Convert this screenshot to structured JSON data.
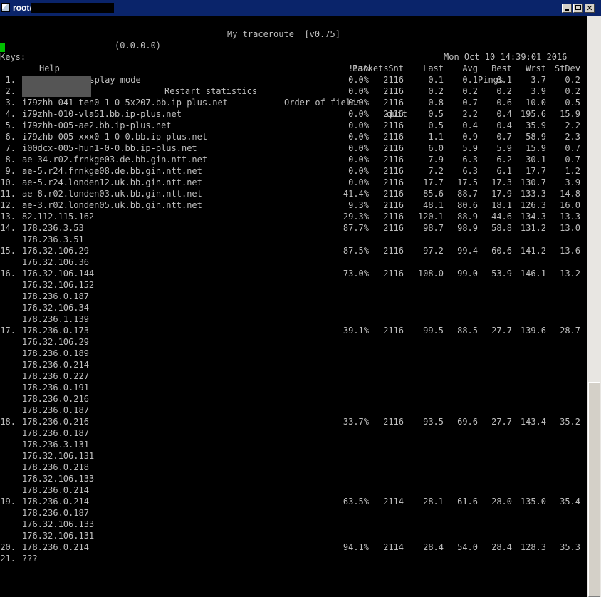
{
  "window": {
    "title": "root@",
    "buttons": {
      "minimize": "minimize",
      "maximize": "maximize",
      "close": "✕"
    }
  },
  "mtr": {
    "title": "My traceroute  [v0.75]",
    "address": "(0.0.0.0)",
    "datetime": "Mon Oct 10 14:39:01 2016",
    "keys_label": "Keys:",
    "menu": [
      "Help",
      "Display mode",
      "Restart statistics",
      "Order of fields",
      "quit"
    ],
    "group_headers": {
      "packets": "Packets",
      "pings": "Pings"
    },
    "columns": [
      "!!s%",
      "Snt",
      "Last",
      "Avg",
      "Best",
      "Wrst",
      "StDev"
    ],
    "hops": [
      {
        "n": "1.",
        "hosts": [
          ""
        ],
        "loss": "0.0%",
        "snt": "2116",
        "last": "0.1",
        "avg": "0.1",
        "best": "0.1",
        "wrst": "3.7",
        "stdev": "0.2"
      },
      {
        "n": "2.",
        "hosts": [
          ""
        ],
        "loss": "0.0%",
        "snt": "2116",
        "last": "0.2",
        "avg": "0.2",
        "best": "0.2",
        "wrst": "3.9",
        "stdev": "0.2"
      },
      {
        "n": "3.",
        "hosts": [
          "i79zhh-041-ten0-1-0-5x207.bb.ip-plus.net"
        ],
        "loss": "0.0%",
        "snt": "2116",
        "last": "0.8",
        "avg": "0.7",
        "best": "0.6",
        "wrst": "10.0",
        "stdev": "0.5"
      },
      {
        "n": "4.",
        "hosts": [
          "i79zhh-010-vla51.bb.ip-plus.net"
        ],
        "loss": "0.0%",
        "snt": "2116",
        "last": "0.5",
        "avg": "2.2",
        "best": "0.4",
        "wrst": "195.6",
        "stdev": "15.9"
      },
      {
        "n": "5.",
        "hosts": [
          "i79zhh-005-ae2.bb.ip-plus.net"
        ],
        "loss": "0.0%",
        "snt": "2116",
        "last": "0.5",
        "avg": "0.4",
        "best": "0.4",
        "wrst": "35.9",
        "stdev": "2.2"
      },
      {
        "n": "6.",
        "hosts": [
          "i79zhb-005-xxx0-1-0-0.bb.ip-plus.net"
        ],
        "loss": "0.0%",
        "snt": "2116",
        "last": "1.1",
        "avg": "0.9",
        "best": "0.7",
        "wrst": "58.9",
        "stdev": "2.3"
      },
      {
        "n": "7.",
        "hosts": [
          "i00dcx-005-hun1-0-0.bb.ip-plus.net"
        ],
        "loss": "0.0%",
        "snt": "2116",
        "last": "6.0",
        "avg": "5.9",
        "best": "5.9",
        "wrst": "15.9",
        "stdev": "0.7"
      },
      {
        "n": "8.",
        "hosts": [
          "ae-34.r02.frnkge03.de.bb.gin.ntt.net"
        ],
        "loss": "0.0%",
        "snt": "2116",
        "last": "7.9",
        "avg": "6.3",
        "best": "6.2",
        "wrst": "30.1",
        "stdev": "0.7"
      },
      {
        "n": "9.",
        "hosts": [
          "ae-5.r24.frnkge08.de.bb.gin.ntt.net"
        ],
        "loss": "0.0%",
        "snt": "2116",
        "last": "7.2",
        "avg": "6.3",
        "best": "6.1",
        "wrst": "17.7",
        "stdev": "1.2"
      },
      {
        "n": "10.",
        "hosts": [
          "ae-5.r24.londen12.uk.bb.gin.ntt.net"
        ],
        "loss": "0.0%",
        "snt": "2116",
        "last": "17.7",
        "avg": "17.5",
        "best": "17.3",
        "wrst": "130.7",
        "stdev": "3.9"
      },
      {
        "n": "11.",
        "hosts": [
          "ae-8.r02.londen03.uk.bb.gin.ntt.net"
        ],
        "loss": "41.4%",
        "snt": "2116",
        "last": "85.6",
        "avg": "88.7",
        "best": "17.9",
        "wrst": "133.3",
        "stdev": "14.8"
      },
      {
        "n": "12.",
        "hosts": [
          "ae-3.r02.londen05.uk.bb.gin.ntt.net"
        ],
        "loss": "9.3%",
        "snt": "2116",
        "last": "48.1",
        "avg": "80.6",
        "best": "18.1",
        "wrst": "126.3",
        "stdev": "16.0"
      },
      {
        "n": "13.",
        "hosts": [
          "82.112.115.162"
        ],
        "loss": "29.3%",
        "snt": "2116",
        "last": "120.1",
        "avg": "88.9",
        "best": "44.6",
        "wrst": "134.3",
        "stdev": "13.3"
      },
      {
        "n": "14.",
        "hosts": [
          "178.236.3.53",
          "178.236.3.51"
        ],
        "loss": "87.7%",
        "snt": "2116",
        "last": "98.7",
        "avg": "98.9",
        "best": "58.8",
        "wrst": "131.2",
        "stdev": "13.0"
      },
      {
        "n": "15.",
        "hosts": [
          "176.32.106.29",
          "176.32.106.36"
        ],
        "loss": "87.5%",
        "snt": "2116",
        "last": "97.2",
        "avg": "99.4",
        "best": "60.6",
        "wrst": "141.2",
        "stdev": "13.6"
      },
      {
        "n": "16.",
        "hosts": [
          "176.32.106.144",
          "176.32.106.152",
          "178.236.0.187",
          "176.32.106.34",
          "178.236.1.139"
        ],
        "loss": "73.0%",
        "snt": "2116",
        "last": "108.0",
        "avg": "99.0",
        "best": "53.9",
        "wrst": "146.1",
        "stdev": "13.2"
      },
      {
        "n": "17.",
        "hosts": [
          "178.236.0.173",
          "176.32.106.29",
          "178.236.0.189",
          "178.236.0.214",
          "178.236.0.227",
          "178.236.0.191",
          "178.236.0.216",
          "178.236.0.187"
        ],
        "loss": "39.1%",
        "snt": "2116",
        "last": "99.5",
        "avg": "88.5",
        "best": "27.7",
        "wrst": "139.6",
        "stdev": "28.7"
      },
      {
        "n": "18.",
        "hosts": [
          "178.236.0.216",
          "178.236.0.187",
          "178.236.3.131",
          "176.32.106.131",
          "178.236.0.218",
          "176.32.106.133",
          "178.236.0.214"
        ],
        "loss": "33.7%",
        "snt": "2116",
        "last": "93.5",
        "avg": "69.6",
        "best": "27.7",
        "wrst": "143.4",
        "stdev": "35.2"
      },
      {
        "n": "19.",
        "hosts": [
          "178.236.0.214",
          "178.236.0.187",
          "176.32.106.133",
          "176.32.106.131"
        ],
        "loss": "63.5%",
        "snt": "2114",
        "last": "28.1",
        "avg": "61.6",
        "best": "28.0",
        "wrst": "135.0",
        "stdev": "35.4"
      },
      {
        "n": "20.",
        "hosts": [
          "178.236.0.214"
        ],
        "loss": "94.1%",
        "snt": "2114",
        "last": "28.4",
        "avg": "54.0",
        "best": "28.4",
        "wrst": "128.3",
        "stdev": "35.3"
      },
      {
        "n": "21.",
        "hosts": [
          "???"
        ],
        "loss": "",
        "snt": "",
        "last": "",
        "avg": "",
        "best": "",
        "wrst": "",
        "stdev": ""
      }
    ]
  }
}
